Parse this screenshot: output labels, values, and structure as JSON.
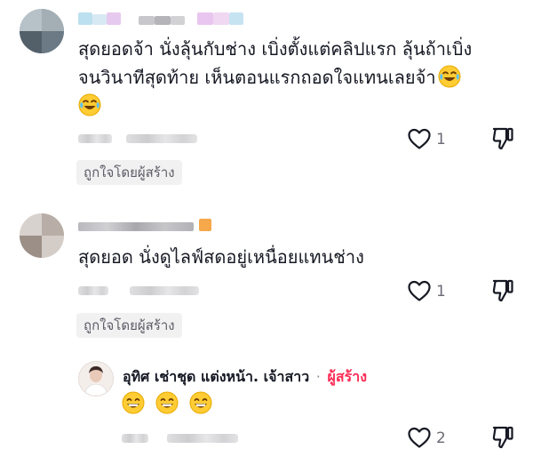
{
  "comments": [
    {
      "text_line1": "สุดยอดจ้า นั่งลุ้นกับช่าง เบิ่งตั้งแต่คลิปแรก ลุ้นถ้าเบิ่ง",
      "text_line2": "จนวินาทีสุดท้าย เห็นตอนแรกถอดใจแทนเลยจ้า",
      "emoji": "face-with-tears-of-joy",
      "like_count": "1",
      "creator_liked_label": "ถูกใจโดยผู้สร้าง"
    },
    {
      "text_line1": "สุดยอด นั่งดูไลฟ์สดอยู่เหนื่อยแทนช่าง",
      "like_count": "1",
      "creator_liked_label": "ถูกใจโดยผู้สร้าง"
    }
  ],
  "reply": {
    "author": "อุทิศ เช่าชุด แต่งหน้า. เจ้าสาว",
    "separator": "·",
    "creator_label": "ผู้สร้าง",
    "emoji": "grinning-face-with-smiling-eyes",
    "like_count": "2"
  },
  "colors": {
    "creator_accent": "#fe2c55",
    "text": "#161823",
    "muted": "#6b6b75",
    "badge_bg": "#f1f1f2"
  },
  "icons": [
    "heart-outline-icon",
    "thumbs-down-outline-icon"
  ]
}
